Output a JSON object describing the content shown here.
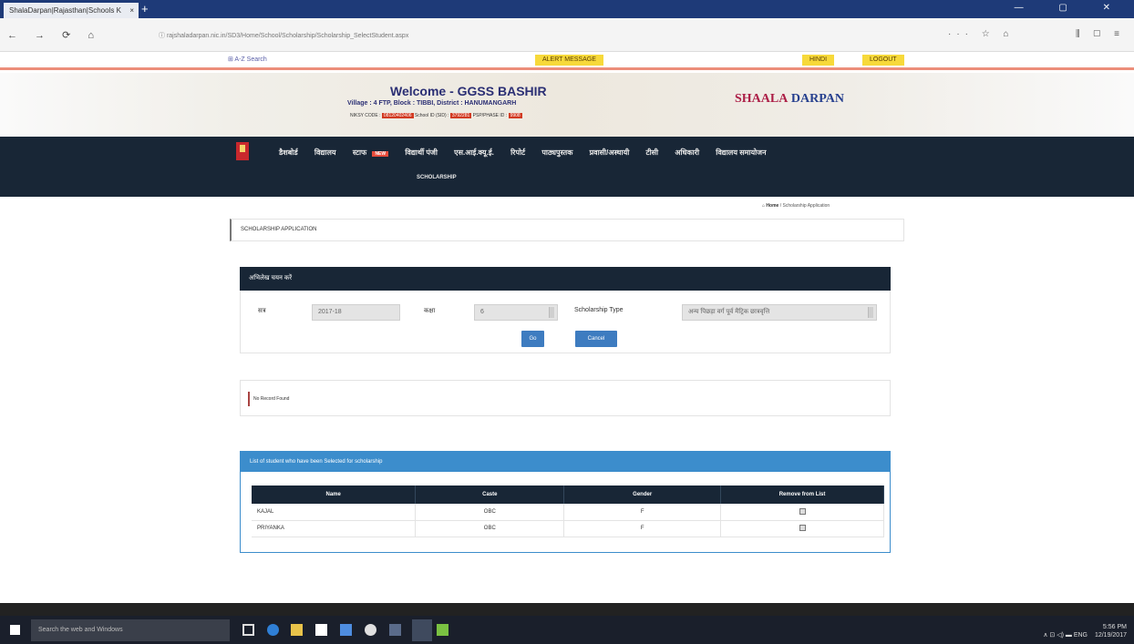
{
  "browser": {
    "tab_title": "ShalaDarpan|Rajasthan|Schools K",
    "tab_close": "×",
    "new_tab": "+",
    "window_controls": "— ▢ ✕",
    "nav_buttons": "← → ⟳ ⌂",
    "url": "ⓘ rajshaladarpan.nic.in/SD3/Home/School/Scholarship/Scholarship_SelectStudent.aspx",
    "toolbar_right": "··· ☆ ⌂",
    "toolbar_far_right": "⫼ ▢ ≡"
  },
  "topstrip": {
    "link": "⊞ A-Z Search",
    "badge_center": "ALERT MESSAGE",
    "badge_right_1": "HINDI",
    "badge_right_2": "LOGOUT"
  },
  "header": {
    "welcome": "Welcome - GGSS BASHIR",
    "subline": "Village : 4 FTP, Block : TIBBI, District : HANUMANGARH",
    "code_1_label": "NIKSY CODE :",
    "code_1_value": "08120402406",
    "code_2_label": "School ID (SID) :",
    "code_2_value": "3792281",
    "code_3_label": "PSP/PHASE ID :",
    "code_3_value": "9908",
    "brand_a": "SHAALA",
    "brand_b": " DARPAN"
  },
  "menu": {
    "items": [
      "डैशबोर्ड",
      "विद्यालय",
      "स्टाफ",
      "विद्यार्थी पंजी",
      "एस.आई.क्यू.ई.",
      "रिपोर्ट",
      "पाठ्यपुस्तक",
      "प्रवासी/अस्थायी",
      "टीसी",
      "अधिकारी",
      "विद्यालय समायोजन"
    ],
    "new_badge": "NEW",
    "row2": "SCHOLARSHIP"
  },
  "breadcrumb": {
    "home": "⌂ Home",
    "current": "/ Scholarship Application"
  },
  "title": "SCHOLARSHIP APPLICATION",
  "form": {
    "heading": "अभिलेख चयन करें",
    "year_label": "सत्र",
    "year_value": "2017-18",
    "class_label": "कक्षा",
    "class_value": "6",
    "type_label": "Scholarship Type",
    "type_value": "अन्य पिछड़ा वर्ग पूर्व मैट्रिक छात्रवृत्ति",
    "go_label": "Go",
    "cancel_label": "Cancel"
  },
  "message": "No Record Found",
  "list": {
    "heading": "List of student who have been Selected for scholarship",
    "columns": [
      "Name",
      "Caste",
      "Gender",
      "Remove from List"
    ],
    "rows": [
      [
        "KAJAL",
        "OBC",
        "F"
      ],
      [
        "PRIYANKA",
        "OBC",
        "F"
      ]
    ]
  },
  "taskbar": {
    "search_placeholder": "Search the web and Windows",
    "tray_left": "∧ ⊡ ◁) ▬ ENG",
    "time": "5:56 PM",
    "date": "12/19/2017"
  },
  "colors": {
    "navy": "#182636",
    "blue": "#3c8dcc",
    "button": "#3e7cc0",
    "yellow_badge": "#f7d93a",
    "accent_red": "#d23a22"
  }
}
